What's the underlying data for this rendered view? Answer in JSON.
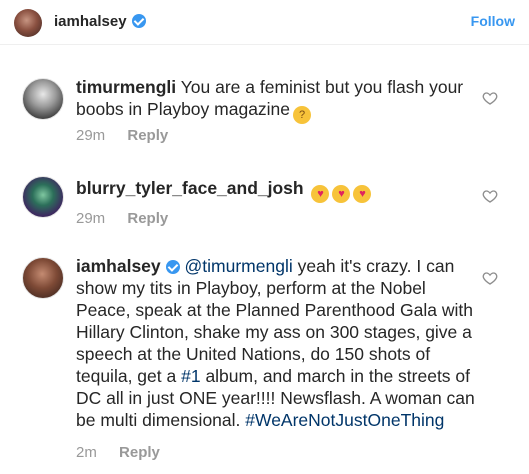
{
  "header": {
    "username": "iamhalsey",
    "follow_label": "Follow"
  },
  "comments": [
    {
      "username": "timurmengli",
      "text": "You are a feminist but you flash your boobs in Playboy magazine",
      "emoji": "thinking-face",
      "time": "29m",
      "reply_label": "Reply"
    },
    {
      "username": "blurry_tyler_face_and_josh",
      "emoji": [
        "heart-eyes-cat",
        "heart-eyes-cat",
        "heart-eyes-cat"
      ],
      "time": "29m",
      "reply_label": "Reply"
    },
    {
      "username": "iamhalsey",
      "mention": "@timurmengli",
      "text_part1": "yeah it's crazy. I can show my tits in Playboy, perform at the Nobel Peace, speak at the Planned Parenthood Gala with Hillary Clinton, shake my ass on 300 stages, give a speech at the United Nations, do 150 shots of tequila, get a",
      "hashtag1": "#1",
      "text_part2": "album, and march in the streets of DC all in just ONE year!!!! Newsflash. A woman can be multi dimensional.",
      "hashtag2": "#WeAreNotJustOneThing",
      "time": "2m",
      "reply_label": "Reply"
    }
  ],
  "colors": {
    "accent": "#3897f0",
    "link": "#003569",
    "meta": "#999999",
    "text": "#262626"
  }
}
